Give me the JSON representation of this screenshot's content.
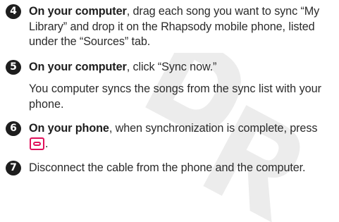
{
  "steps": [
    {
      "number": "4",
      "bold": "On your computer",
      "text": ", drag each song you want to sync “My Library” and drop it on the Rhapsody mobile phone, listed under the “Sources” tab."
    },
    {
      "number": "5",
      "bold": "On your computer",
      "text": ", click “Sync now.”",
      "sub": "You computer syncs the songs from the sync list with your phone."
    },
    {
      "number": "6",
      "bold": "On your phone",
      "text_before_key": ", when synchronization is complete, press ",
      "key_icon": "menu-key-icon",
      "text_after_key": "."
    },
    {
      "number": "7",
      "text": "Disconnect the cable from the phone and the computer."
    }
  ],
  "colors": {
    "text": "#2b2b2b",
    "number_badge": "#1e1e1e",
    "key_icon": "#e0105a",
    "watermark": "#ececec"
  }
}
